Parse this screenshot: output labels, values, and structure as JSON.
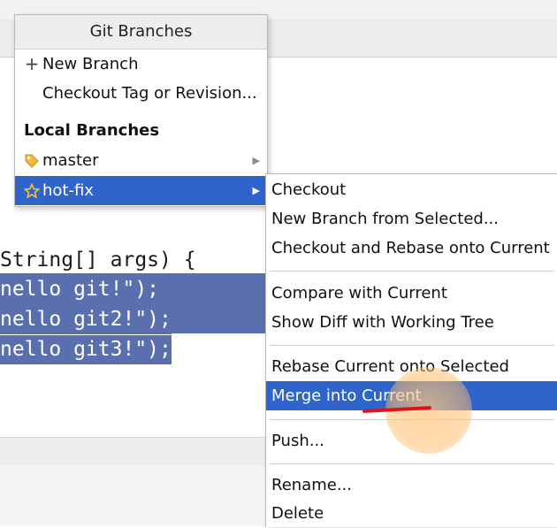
{
  "popup": {
    "title": "Git Branches",
    "new_branch": "New Branch",
    "checkout_tag": "Checkout Tag or Revision...",
    "local_branches_header": "Local Branches",
    "branches": [
      {
        "name": "master",
        "icon": "tag-icon"
      },
      {
        "name": "hot-fix",
        "icon": "star-icon",
        "selected": true
      }
    ]
  },
  "submenu": {
    "checkout": "Checkout",
    "new_branch_from_selected": "New Branch from Selected...",
    "checkout_and_rebase": "Checkout and Rebase onto Current",
    "compare_with_current": "Compare with Current",
    "show_diff": "Show Diff with Working Tree",
    "rebase_current": "Rebase Current onto Selected",
    "merge_into_current": "Merge into Current",
    "push": "Push...",
    "rename": "Rename...",
    "delete": "Delete",
    "highlighted_item": "merge_into_current"
  },
  "editor": {
    "lines": [
      "String[] args) {",
      "nello git!\");",
      "nello git2!\");",
      "nello git3!\");"
    ]
  },
  "colors": {
    "selection_blue": "#2f65ca",
    "code_selection": "#5a6fae",
    "annotation_red": "#e3101a"
  }
}
